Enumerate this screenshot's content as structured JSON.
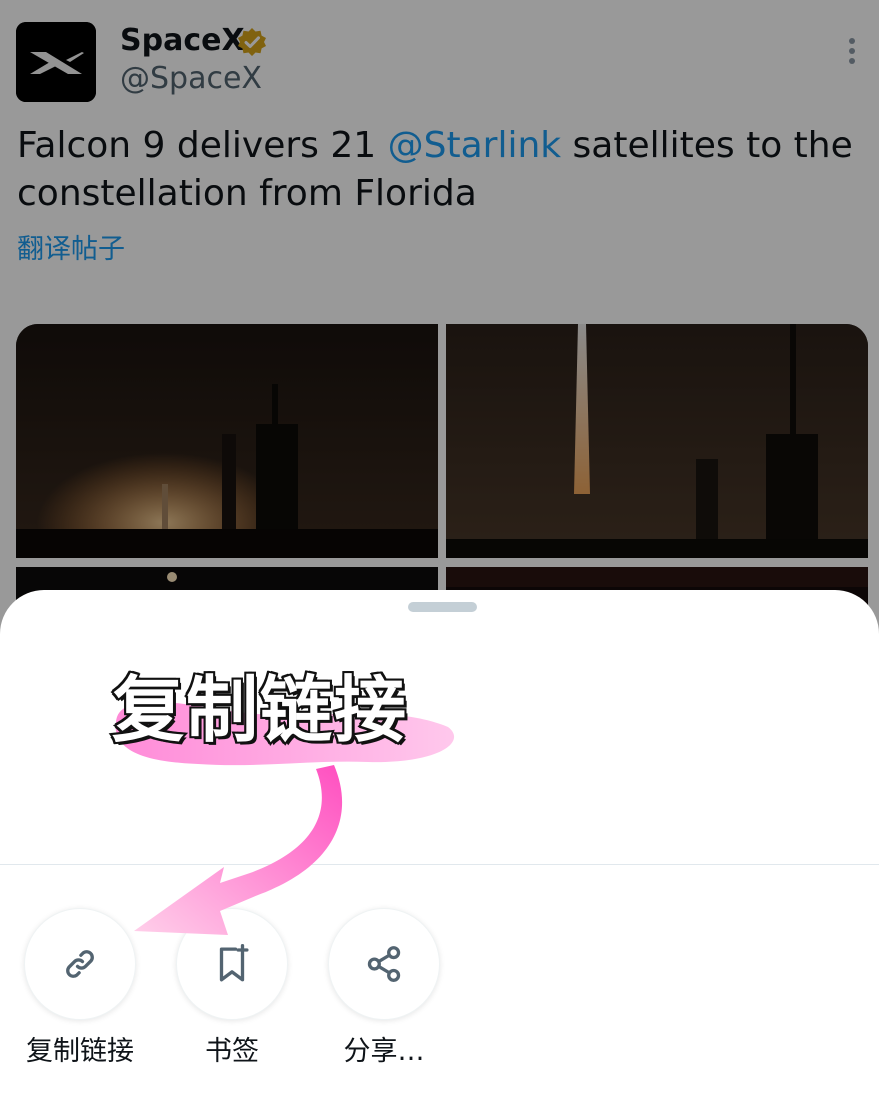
{
  "post": {
    "author_name": "SpaceX",
    "author_handle": "@SpaceX",
    "text_before": "Falcon 9 delivers 21 ",
    "mention": "@Starlink",
    "text_after": " satellites to the constellation from Florida",
    "translate": "翻译帖子",
    "icons": {
      "avatar": "spacex-x-logo",
      "verified": "verified-badge-icon",
      "more": "more-vertical-icon"
    },
    "colors": {
      "link": "#1d9bf0",
      "verified_gold": "#d6a319"
    }
  },
  "sheet": {
    "actions": [
      {
        "label": "复制链接",
        "icon": "link-icon"
      },
      {
        "label": "书签",
        "icon": "bookmark-icon"
      },
      {
        "label": "分享…",
        "icon": "share-icon"
      }
    ]
  },
  "annotation": {
    "text": "复制链接",
    "color": "#ff5fc7",
    "icon": "curved-arrow-icon"
  }
}
